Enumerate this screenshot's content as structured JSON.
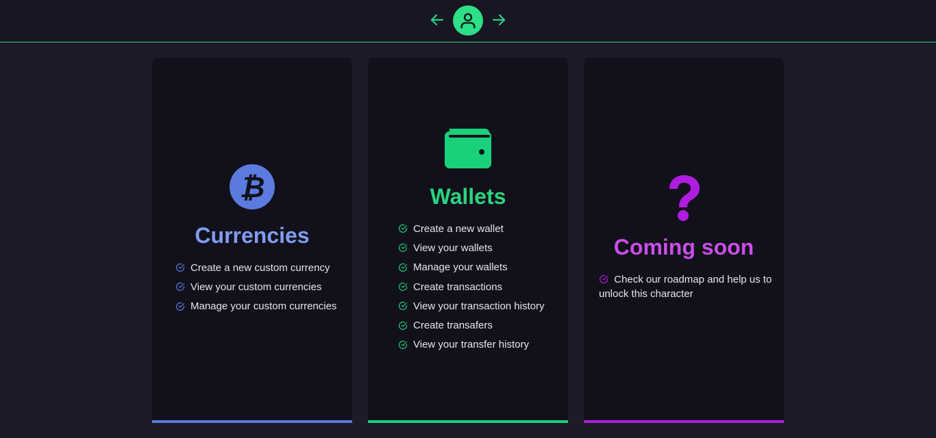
{
  "colors": {
    "background": "#1d1b29",
    "topbar": "#181622",
    "card": "#12111b",
    "accent_green": "#2ddf86",
    "currencies": "#5b7be0",
    "wallets": "#19d17a",
    "coming_soon": "#b11de0"
  },
  "header": {
    "prev_icon": "arrow-left-icon",
    "avatar_icon": "user-icon",
    "next_icon": "arrow-right-icon"
  },
  "cards": [
    {
      "icon": "bitcoin-icon",
      "title": "Currencies",
      "features": [
        "Create a new custom currency",
        "View your custom currencies",
        "Manage your custom currencies"
      ]
    },
    {
      "icon": "wallet-icon",
      "title": "Wallets",
      "features": [
        "Create a new wallet",
        "View your wallets",
        "Manage your wallets",
        "Create transactions",
        "View your transaction history",
        "Create transafers",
        "View your transfer history"
      ]
    },
    {
      "icon": "question-mark-icon",
      "title": "Coming soon",
      "features": [
        "Check our roadmap and help us to unlock this character"
      ]
    }
  ]
}
